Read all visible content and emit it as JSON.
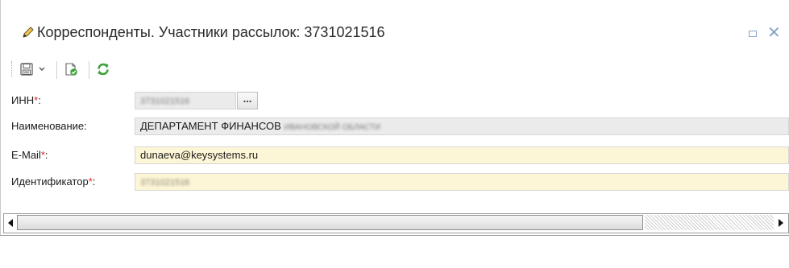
{
  "window": {
    "title": "Корреспонденты. Участники рассылок: 3731021516",
    "restore_icon": "restore-icon",
    "close_glyph": "✕"
  },
  "toolbar": {
    "buttons": [
      {
        "name": "save",
        "icon": "save-icon"
      },
      {
        "name": "save-dropdown",
        "icon": "chevron-down-icon"
      },
      {
        "name": "check",
        "icon": "document-check-icon"
      },
      {
        "name": "refresh",
        "icon": "refresh-icon"
      }
    ]
  },
  "form": {
    "inn": {
      "label": "ИНН",
      "required_mark": "*",
      "colon": ":",
      "value": "3731021516",
      "lookup_button": "..."
    },
    "name": {
      "label": "Наименование:",
      "value_prefix": "ДЕПАРТАМЕНТ ФИНАНСОВ",
      "value_hidden": "ИВАНОВСКОЙ ОБЛАСТИ"
    },
    "email": {
      "label": "E-Mail",
      "required_mark": "*",
      "colon": ":",
      "value": "dunaeva@keysystems.ru"
    },
    "identifier": {
      "label": "Идентификатор",
      "required_mark": "*",
      "colon": ":",
      "value": "3731021516"
    }
  },
  "colors": {
    "required": "#dd2222",
    "readonly_field": "#ebebeb",
    "required_field": "#fdf6d6",
    "accent_green": "#3aa23a"
  }
}
